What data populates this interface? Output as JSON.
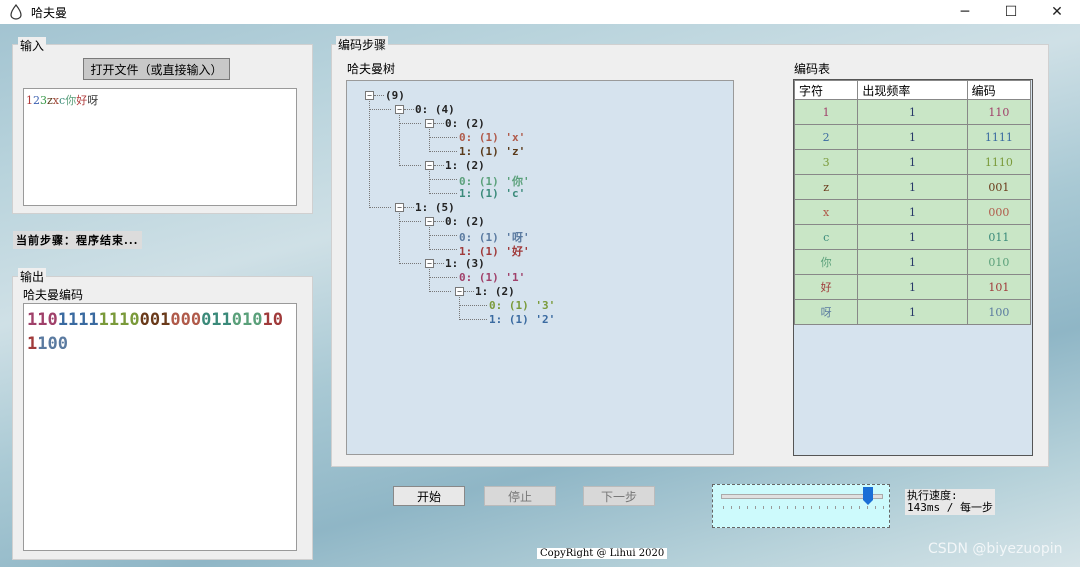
{
  "window": {
    "title": "哈夫曼",
    "minimize": "─",
    "maximize": "☐",
    "close": "✕"
  },
  "input": {
    "group_label": "输入",
    "open_button": "打开文件（或直接输入）",
    "text_segments": [
      {
        "t": "1",
        "c": "#b03a3a"
      },
      {
        "t": "2",
        "c": "#3a5fb0"
      },
      {
        "t": "3",
        "c": "#3a9a4a"
      },
      {
        "t": "z",
        "c": "#5a3a1a"
      },
      {
        "t": "x",
        "c": "#a04a3a"
      },
      {
        "t": "c",
        "c": "#3a8a7a"
      },
      {
        "t": "你",
        "c": "#5aa07a"
      },
      {
        "t": "好",
        "c": "#b03a3a"
      },
      {
        "t": "呀",
        "c": "#333333"
      }
    ]
  },
  "status": {
    "text": "当前步骤：程序结束..."
  },
  "output": {
    "group_label": "输出",
    "subtitle": "哈夫曼编码",
    "code_segments": [
      {
        "t": "110",
        "c": "#a0406a"
      },
      {
        "t": "1111",
        "c": "#3a6aa0"
      },
      {
        "t": "1110",
        "c": "#7a9a3a"
      },
      {
        "t": "001",
        "c": "#6a3a1a"
      },
      {
        "t": "000",
        "c": "#b05a4a"
      },
      {
        "t": "011",
        "c": "#3a8a7a"
      },
      {
        "t": "010",
        "c": "#5aa07a"
      },
      {
        "t": "101",
        "c": "#a03a3a"
      },
      {
        "t": "100",
        "c": "#5a7aa0"
      }
    ]
  },
  "steps": {
    "group_label": "编码步骤",
    "tree_label": "哈夫曼树",
    "table_label": "编码表"
  },
  "tree": [
    {
      "text": "(9)",
      "c": "#222222"
    },
    {
      "text": "0: (4)",
      "c": "#222222"
    },
    {
      "text": "0: (2)",
      "c": "#222222"
    },
    {
      "text": "0: (1) 'x'",
      "c": "#b05a4a"
    },
    {
      "text": "1: (1) 'z'",
      "c": "#5a3a1a"
    },
    {
      "text": "1: (2)",
      "c": "#222222"
    },
    {
      "text": "0: (1) '你'",
      "c": "#5aa07a"
    },
    {
      "text": "1: (1) 'c'",
      "c": "#3a8a7a"
    },
    {
      "text": "1: (5)",
      "c": "#222222"
    },
    {
      "text": "0: (2)",
      "c": "#222222"
    },
    {
      "text": "0: (1) '呀'",
      "c": "#5a7aa0"
    },
    {
      "text": "1: (1) '好'",
      "c": "#a03a3a"
    },
    {
      "text": "1: (3)",
      "c": "#222222"
    },
    {
      "text": "0: (1) '1'",
      "c": "#a0406a"
    },
    {
      "text": "1: (2)",
      "c": "#222222"
    },
    {
      "text": "0: (1) '3'",
      "c": "#7a9a3a"
    },
    {
      "text": "1: (1) '2'",
      "c": "#3a6aa0"
    }
  ],
  "code_table": {
    "headers": [
      "字符",
      "出现频率",
      "编码"
    ],
    "rows": [
      {
        "ch": "1",
        "freq": "1",
        "code": "110",
        "c": "#a0406a"
      },
      {
        "ch": "2",
        "freq": "1",
        "code": "1111",
        "c": "#3a6aa0"
      },
      {
        "ch": "3",
        "freq": "1",
        "code": "1110",
        "c": "#7a9a3a"
      },
      {
        "ch": "z",
        "freq": "1",
        "code": "001",
        "c": "#6a3a1a"
      },
      {
        "ch": "x",
        "freq": "1",
        "code": "000",
        "c": "#b05a4a"
      },
      {
        "ch": "c",
        "freq": "1",
        "code": "011",
        "c": "#3a8a7a"
      },
      {
        "ch": "你",
        "freq": "1",
        "code": "010",
        "c": "#5aa07a"
      },
      {
        "ch": "好",
        "freq": "1",
        "code": "101",
        "c": "#a03a3a"
      },
      {
        "ch": "呀",
        "freq": "1",
        "code": "100",
        "c": "#5a7aa0"
      }
    ]
  },
  "controls": {
    "start": "开始",
    "stop": "停止",
    "next": "下一步"
  },
  "speed": {
    "label": "执行速度:",
    "value": "143ms / 每一步",
    "slider_fraction": 0.92
  },
  "copyright": "CopyRight @ Lihui 2020",
  "watermark": "CSDN @biyezuopin",
  "colors": {
    "table_cell_bg": "#c9e6c6",
    "tree_bg": "#d6e3ee",
    "slider_bg": "#cdfafc",
    "thumb": "#1a6fd6"
  }
}
